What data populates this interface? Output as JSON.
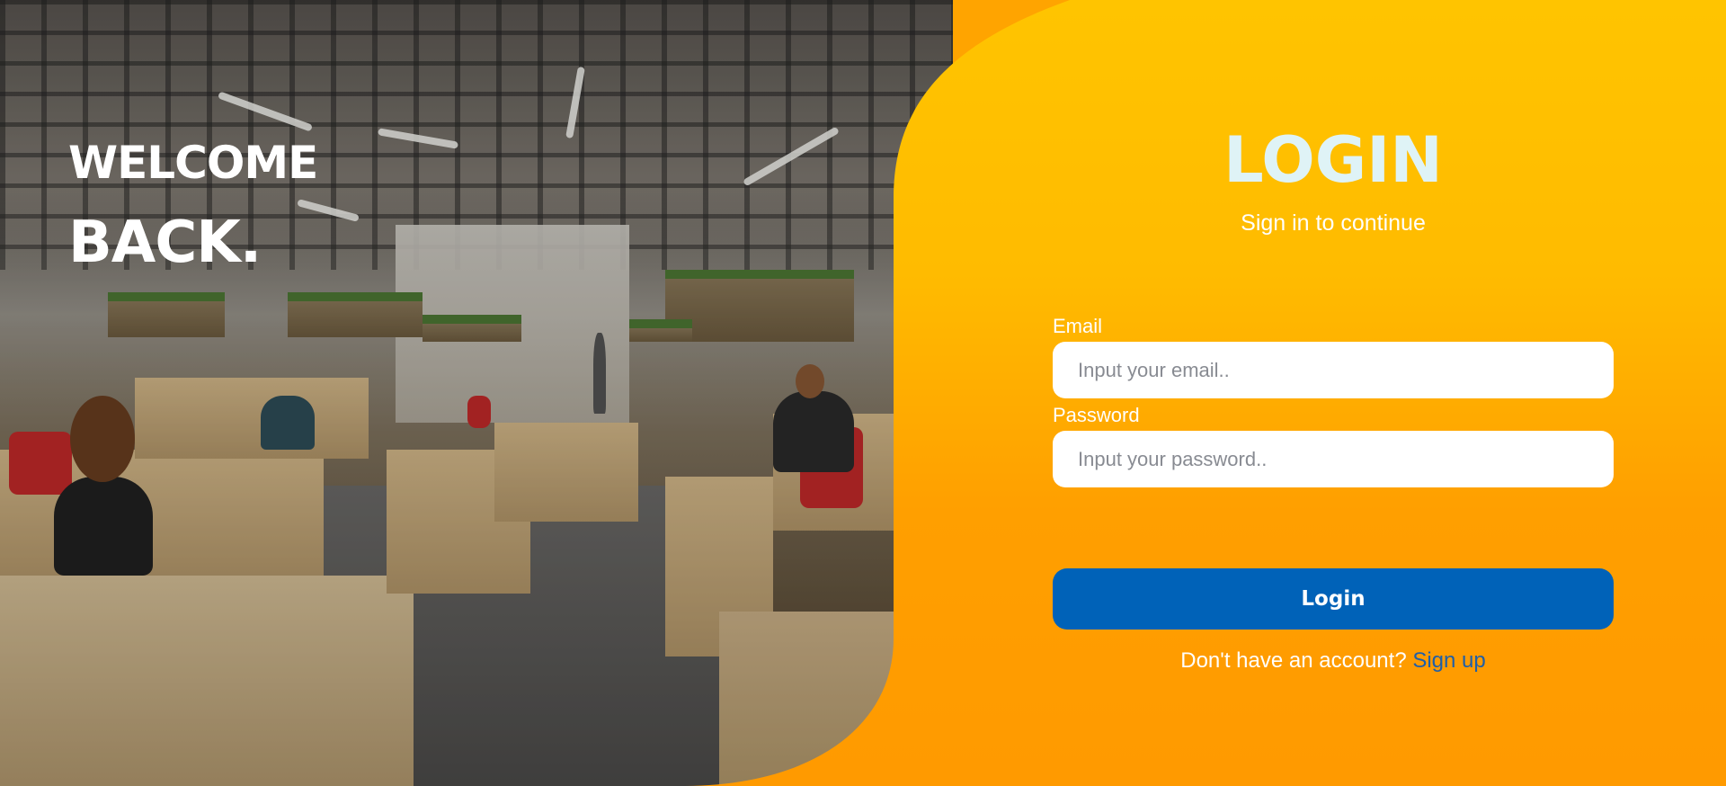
{
  "hero": {
    "line1": "WELCOME",
    "line2": "BACK."
  },
  "form": {
    "title": "LOGIN",
    "subtitle": "Sign in to continue",
    "email_label": "Email",
    "email_placeholder": "Input your email..",
    "email_value": "",
    "password_label": "Password",
    "password_placeholder": "Input your password..",
    "password_value": "",
    "submit_label": "Login",
    "signup_prompt": "Don't have an account?",
    "signup_link": "Sign up"
  },
  "colors": {
    "panel_top": "#ffc400",
    "panel_bottom": "#ff9900",
    "title": "#dff3f6",
    "button": "#0062b8",
    "link": "#1f5fa8"
  }
}
